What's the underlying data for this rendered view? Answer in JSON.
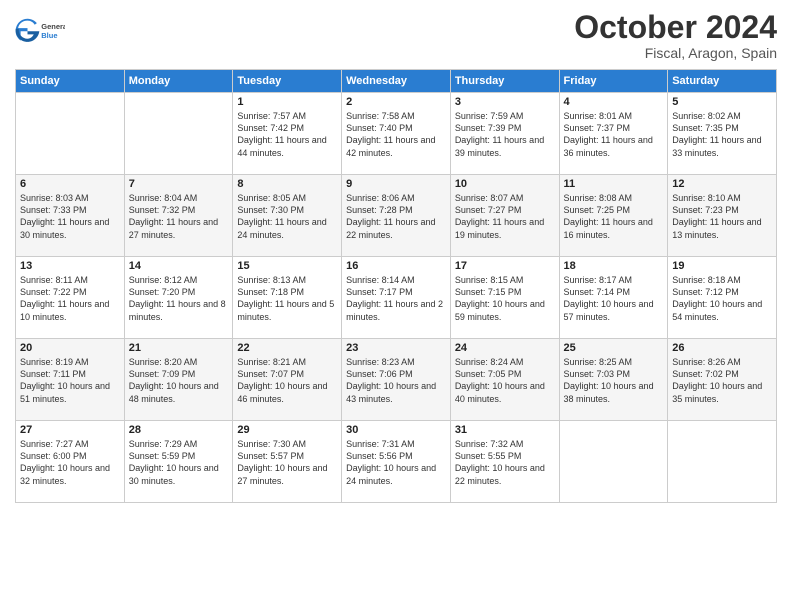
{
  "header": {
    "logo_general": "General",
    "logo_blue": "Blue",
    "month_title": "October 2024",
    "location": "Fiscal, Aragon, Spain"
  },
  "days_of_week": [
    "Sunday",
    "Monday",
    "Tuesday",
    "Wednesday",
    "Thursday",
    "Friday",
    "Saturday"
  ],
  "weeks": [
    [
      {
        "day": "",
        "info": ""
      },
      {
        "day": "",
        "info": ""
      },
      {
        "day": "1",
        "info": "Sunrise: 7:57 AM\nSunset: 7:42 PM\nDaylight: 11 hours and 44 minutes."
      },
      {
        "day": "2",
        "info": "Sunrise: 7:58 AM\nSunset: 7:40 PM\nDaylight: 11 hours and 42 minutes."
      },
      {
        "day": "3",
        "info": "Sunrise: 7:59 AM\nSunset: 7:39 PM\nDaylight: 11 hours and 39 minutes."
      },
      {
        "day": "4",
        "info": "Sunrise: 8:01 AM\nSunset: 7:37 PM\nDaylight: 11 hours and 36 minutes."
      },
      {
        "day": "5",
        "info": "Sunrise: 8:02 AM\nSunset: 7:35 PM\nDaylight: 11 hours and 33 minutes."
      }
    ],
    [
      {
        "day": "6",
        "info": "Sunrise: 8:03 AM\nSunset: 7:33 PM\nDaylight: 11 hours and 30 minutes."
      },
      {
        "day": "7",
        "info": "Sunrise: 8:04 AM\nSunset: 7:32 PM\nDaylight: 11 hours and 27 minutes."
      },
      {
        "day": "8",
        "info": "Sunrise: 8:05 AM\nSunset: 7:30 PM\nDaylight: 11 hours and 24 minutes."
      },
      {
        "day": "9",
        "info": "Sunrise: 8:06 AM\nSunset: 7:28 PM\nDaylight: 11 hours and 22 minutes."
      },
      {
        "day": "10",
        "info": "Sunrise: 8:07 AM\nSunset: 7:27 PM\nDaylight: 11 hours and 19 minutes."
      },
      {
        "day": "11",
        "info": "Sunrise: 8:08 AM\nSunset: 7:25 PM\nDaylight: 11 hours and 16 minutes."
      },
      {
        "day": "12",
        "info": "Sunrise: 8:10 AM\nSunset: 7:23 PM\nDaylight: 11 hours and 13 minutes."
      }
    ],
    [
      {
        "day": "13",
        "info": "Sunrise: 8:11 AM\nSunset: 7:22 PM\nDaylight: 11 hours and 10 minutes."
      },
      {
        "day": "14",
        "info": "Sunrise: 8:12 AM\nSunset: 7:20 PM\nDaylight: 11 hours and 8 minutes."
      },
      {
        "day": "15",
        "info": "Sunrise: 8:13 AM\nSunset: 7:18 PM\nDaylight: 11 hours and 5 minutes."
      },
      {
        "day": "16",
        "info": "Sunrise: 8:14 AM\nSunset: 7:17 PM\nDaylight: 11 hours and 2 minutes."
      },
      {
        "day": "17",
        "info": "Sunrise: 8:15 AM\nSunset: 7:15 PM\nDaylight: 10 hours and 59 minutes."
      },
      {
        "day": "18",
        "info": "Sunrise: 8:17 AM\nSunset: 7:14 PM\nDaylight: 10 hours and 57 minutes."
      },
      {
        "day": "19",
        "info": "Sunrise: 8:18 AM\nSunset: 7:12 PM\nDaylight: 10 hours and 54 minutes."
      }
    ],
    [
      {
        "day": "20",
        "info": "Sunrise: 8:19 AM\nSunset: 7:11 PM\nDaylight: 10 hours and 51 minutes."
      },
      {
        "day": "21",
        "info": "Sunrise: 8:20 AM\nSunset: 7:09 PM\nDaylight: 10 hours and 48 minutes."
      },
      {
        "day": "22",
        "info": "Sunrise: 8:21 AM\nSunset: 7:07 PM\nDaylight: 10 hours and 46 minutes."
      },
      {
        "day": "23",
        "info": "Sunrise: 8:23 AM\nSunset: 7:06 PM\nDaylight: 10 hours and 43 minutes."
      },
      {
        "day": "24",
        "info": "Sunrise: 8:24 AM\nSunset: 7:05 PM\nDaylight: 10 hours and 40 minutes."
      },
      {
        "day": "25",
        "info": "Sunrise: 8:25 AM\nSunset: 7:03 PM\nDaylight: 10 hours and 38 minutes."
      },
      {
        "day": "26",
        "info": "Sunrise: 8:26 AM\nSunset: 7:02 PM\nDaylight: 10 hours and 35 minutes."
      }
    ],
    [
      {
        "day": "27",
        "info": "Sunrise: 7:27 AM\nSunset: 6:00 PM\nDaylight: 10 hours and 32 minutes."
      },
      {
        "day": "28",
        "info": "Sunrise: 7:29 AM\nSunset: 5:59 PM\nDaylight: 10 hours and 30 minutes."
      },
      {
        "day": "29",
        "info": "Sunrise: 7:30 AM\nSunset: 5:57 PM\nDaylight: 10 hours and 27 minutes."
      },
      {
        "day": "30",
        "info": "Sunrise: 7:31 AM\nSunset: 5:56 PM\nDaylight: 10 hours and 24 minutes."
      },
      {
        "day": "31",
        "info": "Sunrise: 7:32 AM\nSunset: 5:55 PM\nDaylight: 10 hours and 22 minutes."
      },
      {
        "day": "",
        "info": ""
      },
      {
        "day": "",
        "info": ""
      }
    ]
  ]
}
